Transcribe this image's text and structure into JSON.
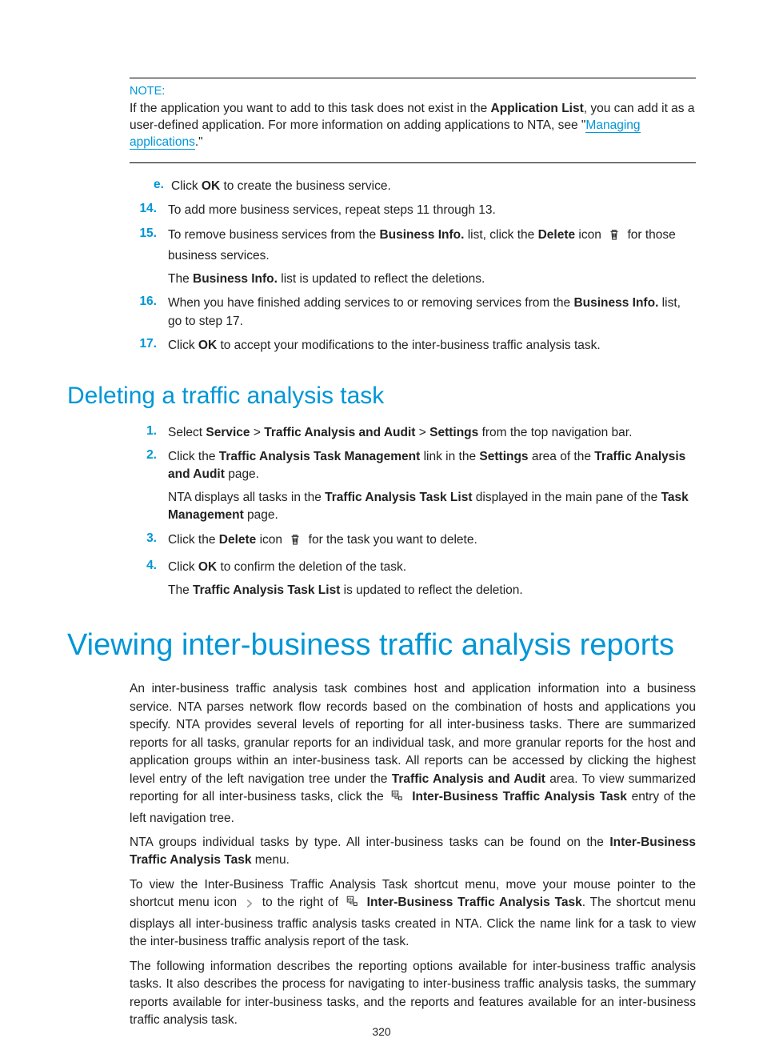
{
  "note": {
    "label": "NOTE:",
    "part1": "If the application you want to add to this task does not exist in the ",
    "app_list": "Application List",
    "part2": ", you can add it as a user-defined application. For more information on adding applications to NTA, see \"",
    "link": "Managing applications",
    "part3": ".\""
  },
  "substep_e": {
    "letter": "e.",
    "text_a": "Click ",
    "ok": "OK",
    "text_b": " to create the business service."
  },
  "steps_a": [
    {
      "num": "14.",
      "body": "To add more business services, repeat steps 11 through 13."
    },
    {
      "num": "15.",
      "body_pre": "To remove business services from the ",
      "b1": "Business Info.",
      "body_mid": " list, click the ",
      "b2": "Delete",
      "body_mid2": " icon ",
      "body_post": " for those business services.",
      "follow_pre": "The ",
      "follow_b": "Business Info.",
      "follow_post": " list is updated to reflect the deletions."
    },
    {
      "num": "16.",
      "body_pre": "When you have finished adding services to or removing services from the ",
      "b1": "Business Info.",
      "body_post": " list, go to step 17."
    },
    {
      "num": "17.",
      "body_pre": "Click ",
      "b1": "OK",
      "body_post": " to accept your modifications to the inter-business traffic analysis task."
    }
  ],
  "h2": "Deleting a traffic analysis task",
  "steps_b": [
    {
      "num": "1.",
      "pre": "Select ",
      "b1": "Service",
      "s1": " > ",
      "b2": "Traffic Analysis and Audit",
      "s2": " > ",
      "b3": "Settings",
      "post": " from the top navigation bar."
    },
    {
      "num": "2.",
      "pre": "Click the ",
      "b1": "Traffic Analysis Task Management",
      "mid1": " link in the ",
      "b2": "Settings",
      "mid2": " area of the ",
      "b3": "Traffic Analysis and Audit",
      "post": " page.",
      "follow_pre": "NTA displays all tasks in the ",
      "follow_b1": "Traffic Analysis Task List",
      "follow_mid": " displayed in the main pane of the ",
      "follow_b2": "Task Management",
      "follow_post": " page."
    },
    {
      "num": "3.",
      "pre": "Click the ",
      "b1": "Delete",
      "mid": " icon ",
      "post": " for the task you want to delete."
    },
    {
      "num": "4.",
      "pre": "Click ",
      "b1": "OK",
      "post": " to confirm the deletion of the task.",
      "follow_pre": "The ",
      "follow_b1": "Traffic Analysis Task List",
      "follow_post": " is updated to reflect the deletion."
    }
  ],
  "h1": "Viewing inter-business traffic analysis reports",
  "p1": {
    "pre": "An inter-business traffic analysis task combines host and application information into a business service. NTA parses network flow records based on the combination of hosts and applications you specify. NTA provides several levels of reporting for all inter-business tasks. There are summarized reports for all tasks, granular reports for an individual task, and more granular reports for the host and application groups within an inter-business task. All reports can be accessed by clicking the highest level entry of the left navigation tree under the ",
    "b1": "Traffic Analysis and Audit",
    "mid1": " area. To view summarized reporting for all inter-business tasks, click the ",
    "b2": "Inter-Business Traffic Analysis Task",
    "post": " entry of the left navigation tree."
  },
  "p2": {
    "pre": "NTA groups individual tasks by type. All inter-business tasks can be found on the ",
    "b1": "Inter-Business Traffic Analysis Task",
    "post": " menu."
  },
  "p3": {
    "pre": "To view the Inter-Business Traffic Analysis Task shortcut menu, move your mouse pointer to the shortcut menu icon ",
    "mid1": " to the right of ",
    "b1": "Inter-Business Traffic Analysis Task",
    "post": ". The shortcut menu displays all inter-business traffic analysis tasks created in NTA. Click the name link for a task to view the inter-business traffic analysis report of the task."
  },
  "p4": "The following information describes the reporting options available for inter-business traffic analysis tasks. It also describes the process for navigating to inter-business traffic analysis tasks, the summary reports available for inter-business tasks, and the reports and features available for an inter-business traffic analysis task.",
  "page_number": "320"
}
